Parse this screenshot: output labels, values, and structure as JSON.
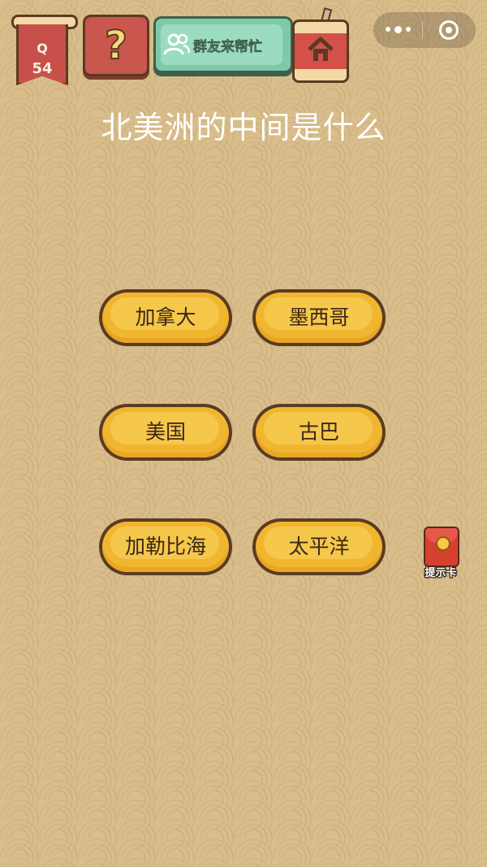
{
  "header": {
    "level_prefix": "Q",
    "level_number": "54",
    "help_symbol": "?",
    "share_label": "群友来帮忙"
  },
  "question": "北美洲的中间是什么",
  "options": [
    "加拿大",
    "墨西哥",
    "美国",
    "古巴",
    "加勒比海",
    "太平洋"
  ],
  "hint": {
    "label": "提示卡"
  },
  "colors": {
    "background": "#d9bd8b",
    "option_fill": "#f1b62f",
    "option_border": "#5a3b23",
    "share_button": "#7ec9a9",
    "help_button": "#c9574e"
  },
  "icons": {
    "level_badge": "banner-flag-icon",
    "help": "question-mark-icon",
    "share": "group-users-icon",
    "home": "home-icon",
    "more": "more-dots-icon",
    "close": "close-circle-icon",
    "hint": "red-envelope-icon"
  }
}
